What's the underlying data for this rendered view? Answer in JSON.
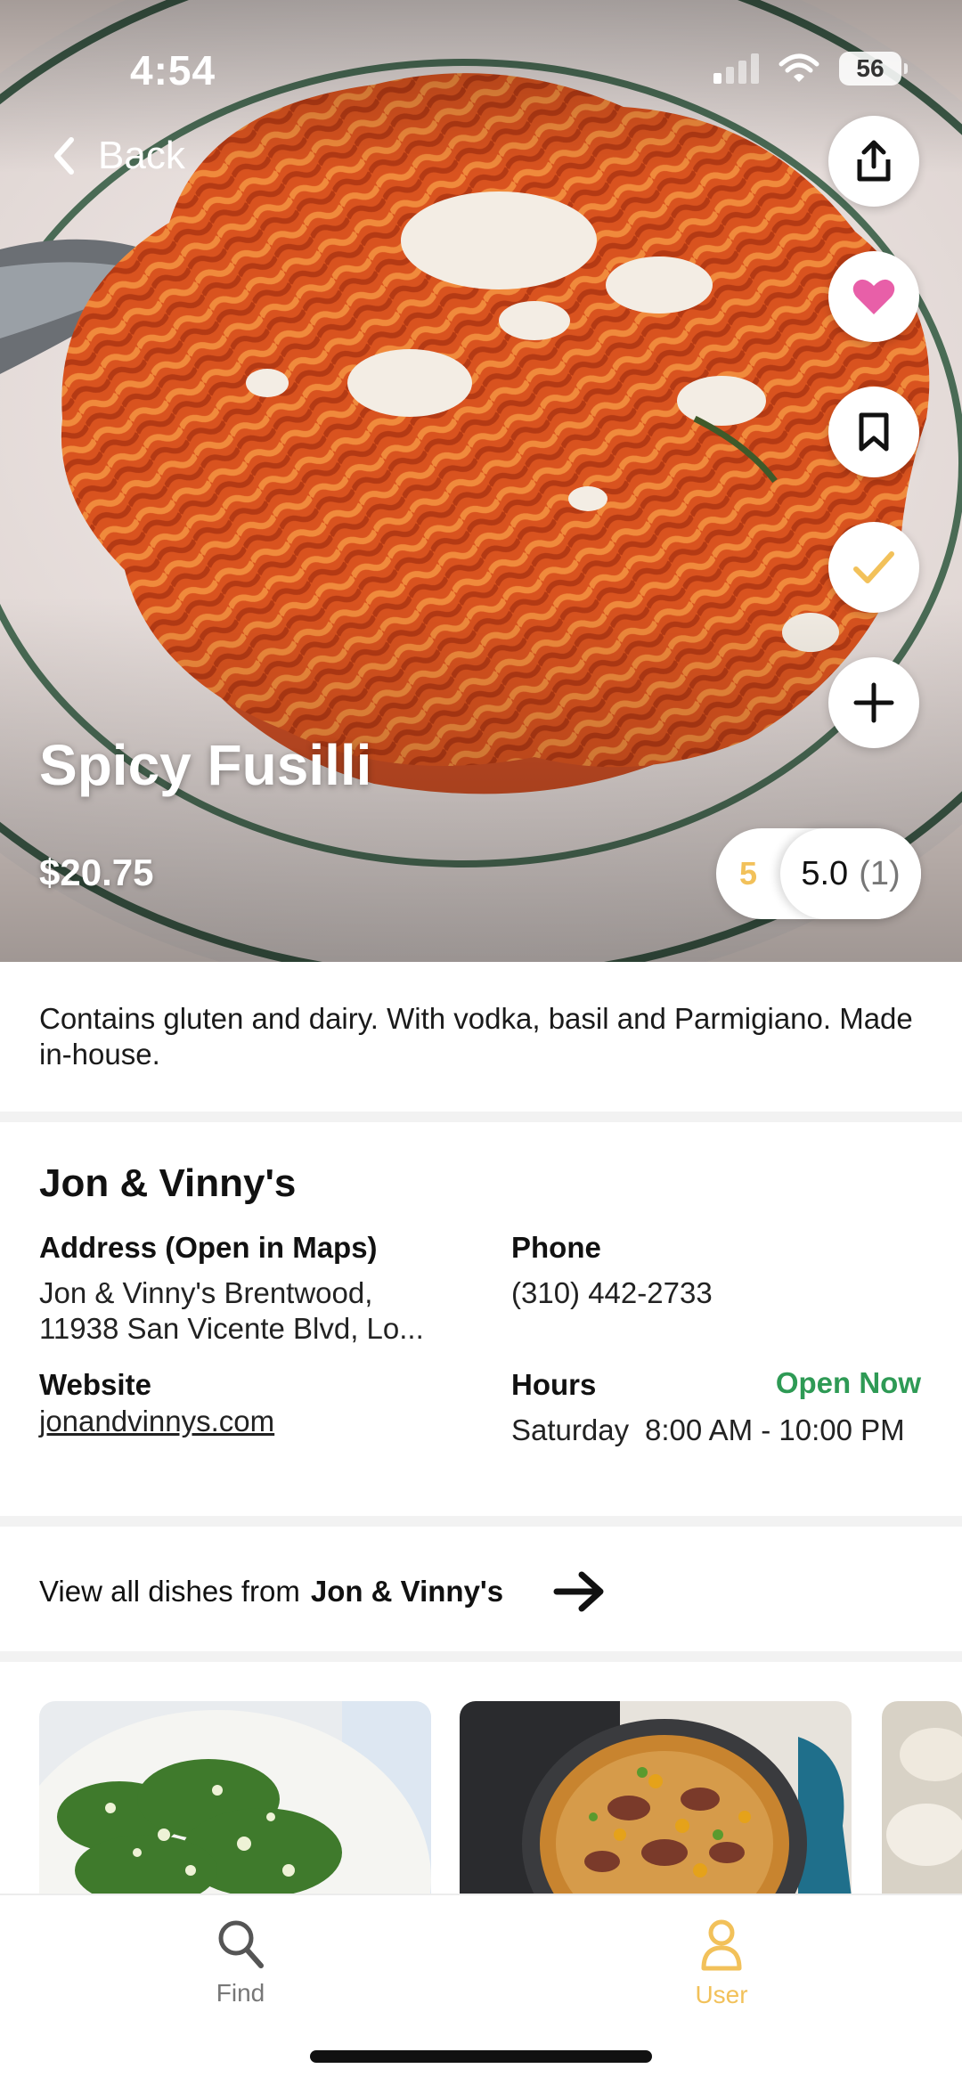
{
  "status_bar": {
    "time": "4:54",
    "battery": "56"
  },
  "nav": {
    "back_label": "Back"
  },
  "actions": {
    "share_icon": "share-icon",
    "favorite_icon": "heart-icon",
    "bookmark_icon": "bookmark-icon",
    "tried_icon": "check-icon",
    "add_icon": "plus-icon"
  },
  "dish": {
    "name": "Spicy Fusilli",
    "price": "$20.75",
    "user_rating": "5",
    "avg_rating": "5.0",
    "rating_count": "(1)",
    "description": "Contains gluten and dairy. With vodka, basil and Parmigiano. Made in-house."
  },
  "restaurant": {
    "name": "Jon & Vinny's",
    "address_label": "Address (Open in Maps)",
    "address_line1": "Jon & Vinny's Brentwood,",
    "address_line2": "11938 San Vicente Blvd, Lo...",
    "phone_label": "Phone",
    "phone": "(310) 442-2733",
    "website_label": "Website",
    "website": "jonandvinnys.com",
    "hours_label": "Hours",
    "open_status": "Open Now",
    "hours_day": "Saturday",
    "hours_time": "8:00 AM - 10:00 PM"
  },
  "view_all": {
    "prefix": "View all dishes from",
    "restaurant": "Jon & Vinny's"
  },
  "tabs": [
    {
      "label": "Find",
      "icon": "search-icon"
    },
    {
      "label": "User",
      "icon": "user-icon"
    }
  ],
  "colors": {
    "accent": "#f2c15a",
    "favorite": "#e85fa8",
    "open": "#2e9a55"
  }
}
